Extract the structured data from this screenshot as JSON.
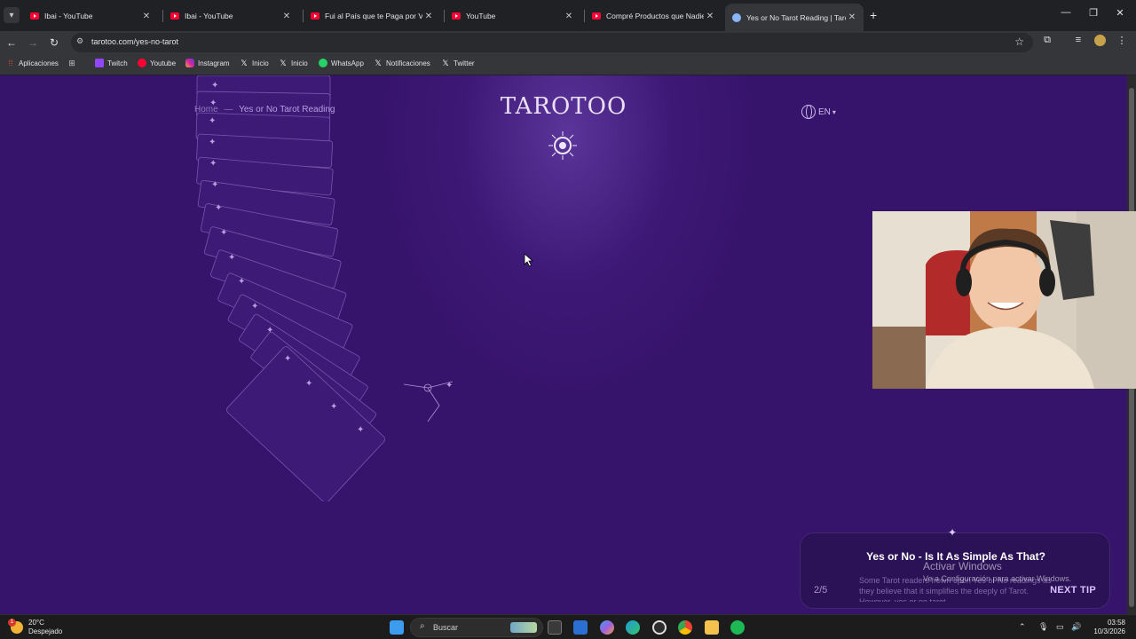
{
  "browser": {
    "tabs": [
      {
        "title": "Ibai - YouTube",
        "icon": "youtube-icon"
      },
      {
        "title": "Ibai - YouTube",
        "icon": "youtube-icon"
      },
      {
        "title": "Fui al País que te Paga por Visit",
        "icon": "youtube-icon"
      },
      {
        "title": "YouTube",
        "icon": "youtube-icon"
      },
      {
        "title": "Compré Productos que Nadie C",
        "icon": "youtube-icon"
      },
      {
        "title": "Yes or No Tarot Reading | Tarot",
        "icon": "globe-icon",
        "active": true
      }
    ],
    "url": "tarotoo.com/yes-no-tarot",
    "bookmarks": [
      {
        "label": "Aplicaciones",
        "icon": "apps-grid-icon"
      },
      {
        "label": "",
        "icon": "extensions-grid-icon"
      },
      {
        "label": "Twitch",
        "icon": "twitch-icon"
      },
      {
        "label": "Youtube",
        "icon": "youtube-icon"
      },
      {
        "label": "Instagram",
        "icon": "instagram-icon"
      },
      {
        "label": "Inicio",
        "icon": "x-icon"
      },
      {
        "label": "Inicio",
        "icon": "x-icon"
      },
      {
        "label": "WhatsApp",
        "icon": "whatsapp-icon"
      },
      {
        "label": "Notificaciones",
        "icon": "x-icon"
      },
      {
        "label": "Twitter",
        "icon": "x-icon"
      }
    ]
  },
  "page": {
    "breadcrumb": {
      "home": "Home",
      "separator": "—",
      "current": "Yes or No Tarot Reading"
    },
    "logo": "TAROTOO",
    "language": "EN",
    "tip": {
      "title": "Yes or No - Is It As Simple As That?",
      "body": "Some Tarot readers frown upon Yes or No readings as they believe that it simplifies the deeply of Tarot. However, yes or no tarot",
      "counter": "2/5",
      "next_label": "NEXT TIP"
    },
    "colors": {
      "background": "#37146c",
      "accent": "#d6c3ff"
    }
  },
  "windows_watermark": {
    "title": "Activar Windows",
    "subtitle": "Ve a Configuración para activar Windows."
  },
  "taskbar": {
    "weather_temp": "20°C",
    "weather_desc": "Despejado",
    "notification_count": "1",
    "search_placeholder": "Buscar",
    "time": "03:58",
    "date": "10/3/2026"
  }
}
